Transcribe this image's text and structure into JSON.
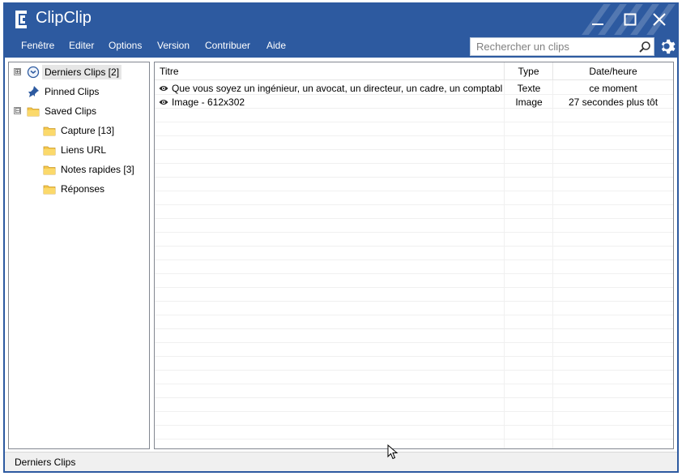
{
  "app": {
    "title": "ClipClip"
  },
  "menu": [
    "Fenêtre",
    "Editer",
    "Options",
    "Version",
    "Contribuer",
    "Aide"
  ],
  "search": {
    "placeholder": "Rechercher un clips",
    "value": ""
  },
  "tree": [
    {
      "label": "Derniers Clips [2]",
      "icon": "clock-icon",
      "expander": "⊞",
      "selected": true
    },
    {
      "label": "Pinned Clips",
      "icon": "pin-icon"
    },
    {
      "label": "Saved Clips",
      "icon": "folder-icon",
      "expander": "⊟"
    },
    {
      "label": "Capture [13]",
      "icon": "folder-icon"
    },
    {
      "label": "Liens URL",
      "icon": "folder-icon"
    },
    {
      "label": "Notes rapides [3]",
      "icon": "folder-icon"
    },
    {
      "label": "Réponses",
      "icon": "folder-icon"
    }
  ],
  "table": {
    "columns": [
      "Titre",
      "Type",
      "Date/heure"
    ],
    "rows": [
      {
        "title": "Que vous soyez un ingénieur, un avocat, un directeur, un cadre, un comptable, un v...",
        "type": "Texte",
        "date": "ce moment"
      },
      {
        "title": "Image - 612x302",
        "type": "Image",
        "date": "27 secondes plus tôt"
      }
    ]
  },
  "status": {
    "text": "Derniers Clips"
  },
  "colors": {
    "titlebar": "#2d5aa0",
    "folder": "#f5c84c",
    "pin": "#2d5aa0"
  }
}
